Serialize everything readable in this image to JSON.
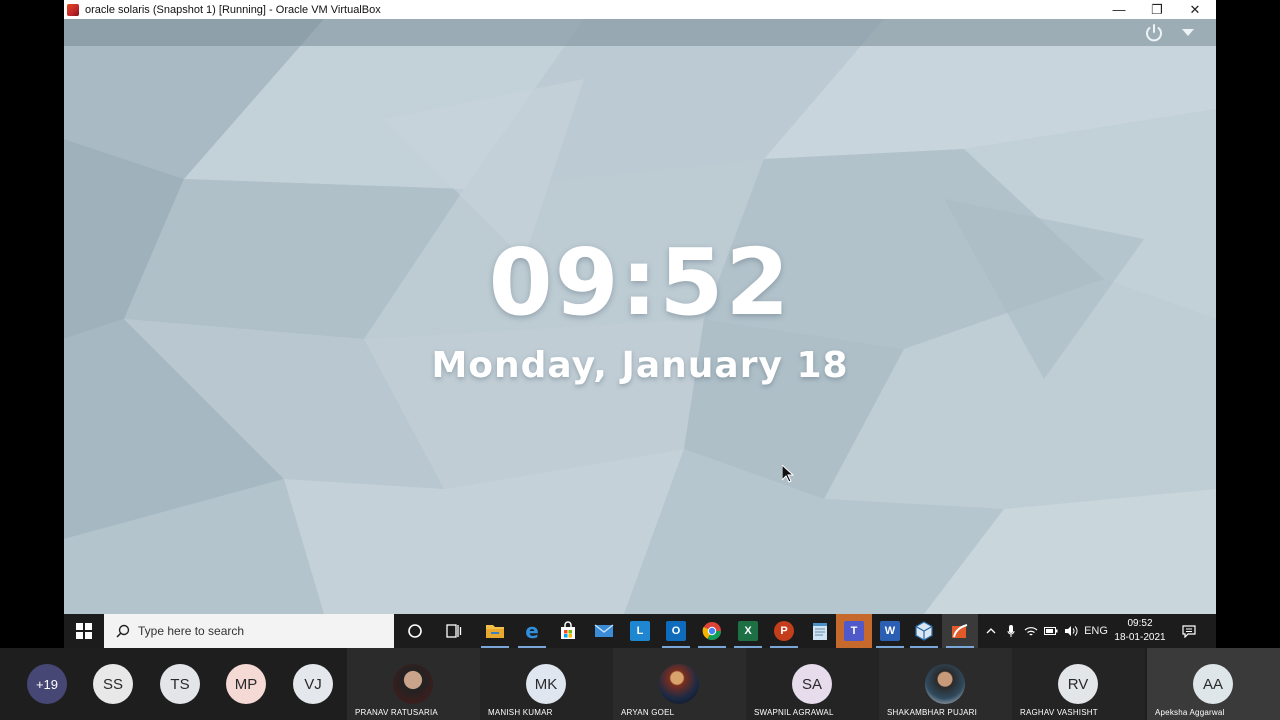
{
  "window": {
    "title": "oracle solaris (Snapshot 1) [Running] - Oracle VM VirtualBox",
    "minimize_glyph": "—",
    "restore_glyph": "❐",
    "close_glyph": "✕"
  },
  "lockscreen": {
    "time": "09:52",
    "date": "Monday, January 18"
  },
  "taskbar": {
    "search_placeholder": "Type here to search",
    "apps": [
      {
        "icon": "cortana-icon"
      },
      {
        "icon": "task-view-icon"
      },
      {
        "icon": "file-explorer-icon"
      },
      {
        "icon": "edge-icon",
        "letter": "e"
      },
      {
        "icon": "store-icon"
      },
      {
        "icon": "mail-icon"
      },
      {
        "icon": "l-app-icon",
        "letter": "L"
      },
      {
        "icon": "outlook-icon",
        "letter": "O"
      },
      {
        "icon": "chrome-icon"
      },
      {
        "icon": "excel-icon",
        "letter": "X"
      },
      {
        "icon": "powerpoint-icon",
        "letter": "P"
      },
      {
        "icon": "notepad-icon"
      },
      {
        "icon": "teams-icon",
        "letter": "T"
      },
      {
        "icon": "word-icon",
        "letter": "W"
      },
      {
        "icon": "virtualbox-icon"
      },
      {
        "icon": "vm-window-icon"
      }
    ],
    "tray": {
      "language": "ENG",
      "time": "09:52",
      "date": "18-01-2021"
    }
  },
  "participants": {
    "overflow": "+19",
    "small": [
      {
        "initials": "SS",
        "color": "#e8e8e8"
      },
      {
        "initials": "TS",
        "color": "#e3e5e8"
      },
      {
        "initials": "MP",
        "color": "#f4d9d4"
      },
      {
        "initials": "VJ",
        "color": "#e4e8ec"
      }
    ],
    "tiles": [
      {
        "name": "PRANAV RATUSARIA",
        "initials": "",
        "photo": true
      },
      {
        "name": "MANISH KUMAR",
        "initials": "MK",
        "color": "#dfe6ef"
      },
      {
        "name": "ARYAN GOEL",
        "initials": "",
        "photo": true
      },
      {
        "name": "SWAPNIL AGRAWAL",
        "initials": "SA",
        "color": "#e6dcec"
      },
      {
        "name": "SHAKAMBHAR PUJARI",
        "initials": "",
        "photo": true
      },
      {
        "name": "RAGHAV VASHISHT",
        "initials": "RV",
        "color": "#e2e6e9"
      },
      {
        "name": "Apeksha Aggarwal",
        "initials": "AA",
        "color": "#dfe6ea"
      }
    ]
  }
}
